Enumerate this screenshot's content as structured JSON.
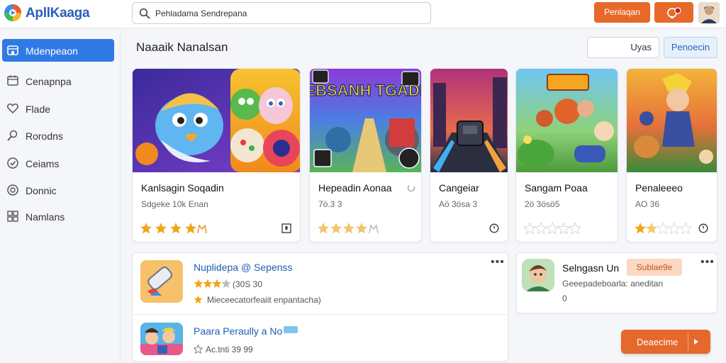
{
  "app": {
    "title": "ApllKaaga"
  },
  "search": {
    "value": "Pehladama Sendrepana"
  },
  "header": {
    "primary_button": "Penlaqan"
  },
  "sidebar": {
    "items": [
      {
        "label": "Mdenpeaon",
        "icon": "storefront-icon",
        "active": true
      },
      {
        "label": "Cenapnpa",
        "icon": "calendar-icon",
        "active": false
      },
      {
        "label": "Flade",
        "icon": "heart-icon",
        "active": false
      },
      {
        "label": "Rorodns",
        "icon": "gamepad-icon",
        "active": false
      },
      {
        "label": "Ceiams",
        "icon": "shield-icon",
        "active": false
      },
      {
        "label": "Donnic",
        "icon": "globe-icon",
        "active": false
      },
      {
        "label": "Namlans",
        "icon": "grid-icon",
        "active": false
      }
    ]
  },
  "main": {
    "section_title": "Naaaik Nanalsan",
    "segment_left": "Uyas",
    "segment_right": "Penoecin",
    "cards": [
      {
        "title": "Kanlsagin Soqadin",
        "sub": "Sdgeke 10k Enan",
        "rating": 4,
        "end_icon": "bookmark-icon"
      },
      {
        "title": "Hepeadin Aonaa",
        "sub": "7ö.3 3",
        "rating": 4,
        "end_icon": ""
      },
      {
        "title": "Cangeiar",
        "sub": "Aö 3ösa 3",
        "rating": 0,
        "end_icon": "clock-icon"
      },
      {
        "title": "Sangam Poaa",
        "sub": "2ö 3ösö5",
        "rating": 0,
        "end_icon": ""
      },
      {
        "title": "Penaleeeo",
        "sub": "AO 36",
        "rating": 2,
        "end_icon": "clock-icon"
      }
    ],
    "card2_art_title": "FEBSANH TGADIO"
  },
  "list": {
    "items": [
      {
        "title": "Nuplidepa @ Sepenss",
        "rating_text": "(30S 30",
        "meta": "Mieceecatorfeaiit enpantacha)"
      },
      {
        "title": "Paara Peraully a No",
        "rating_text": "Ac.tnti 39 99"
      }
    ]
  },
  "profile": {
    "name": "Selngasn Un",
    "tag": "Sublae9e",
    "desc_line1": "Geeepadeboarla: aneditan",
    "desc_line2": "0"
  },
  "cta": {
    "label": "Deaecime"
  },
  "colors": {
    "accent": "#e8682a",
    "primary": "#2f7ae5",
    "link": "#1e5fb3",
    "star": "#f2a516"
  }
}
